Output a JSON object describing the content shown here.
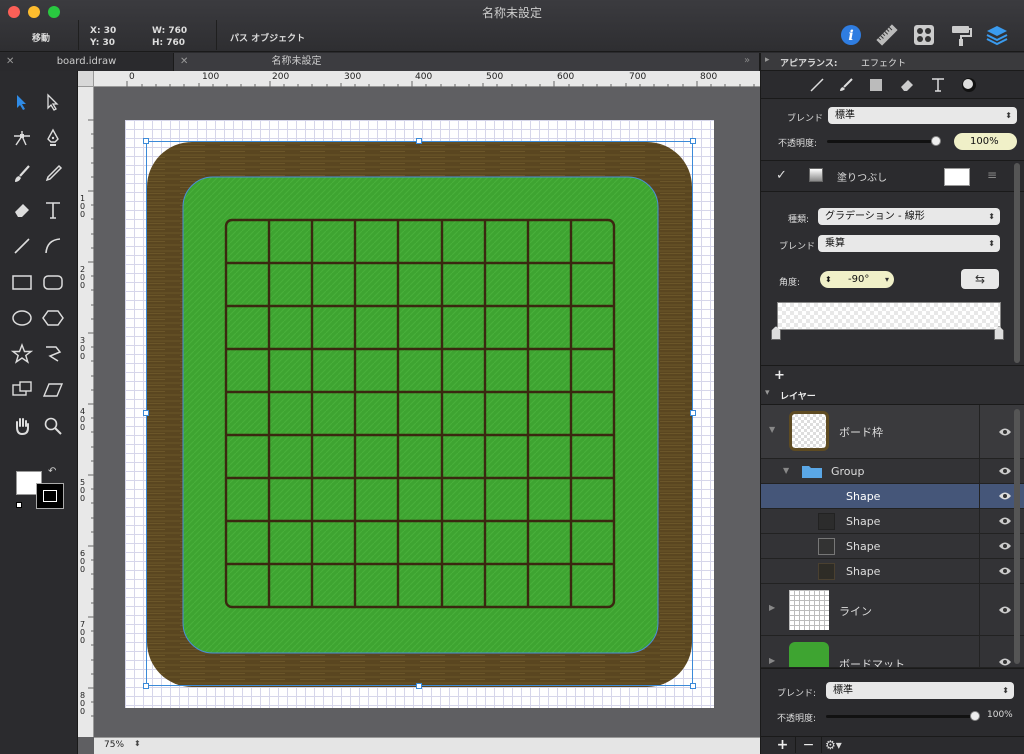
{
  "window": {
    "title": "名称未設定"
  },
  "toolbar": {
    "mode": "移動",
    "x_label": "X:",
    "x_val": "30",
    "y_label": "Y:",
    "y_val": "30",
    "w_label": "W:",
    "w_val": "760",
    "h_label": "H:",
    "h_val": "760",
    "object_type": "パス オブジェクト"
  },
  "tabs": [
    {
      "label": "board.idraw"
    },
    {
      "label": "名称未設定"
    }
  ],
  "ruler": {
    "top": [
      "0",
      "100",
      "200",
      "300",
      "400",
      "500",
      "600",
      "700",
      "800"
    ],
    "left": [
      "100",
      "200",
      "300",
      "400",
      "500",
      "600",
      "700",
      "800"
    ]
  },
  "status": {
    "zoom": "75%"
  },
  "inspector": {
    "header": "アピアランス:",
    "header_sub": "エフェクト",
    "blend_label": "ブレンド",
    "blend_value": "標準",
    "opacity_label": "不透明度:",
    "opacity_value": "100%",
    "fill_label": "塗りつぶし",
    "type_label": "種類:",
    "type_value": "グラデーション - 線形",
    "blend2_label": "ブレンド",
    "blend2_value": "乗算",
    "angle_label": "角度:",
    "angle_value": "-90°",
    "add": "+"
  },
  "layers": {
    "header": "レイヤー",
    "items": [
      {
        "name": "ボード枠"
      },
      {
        "name": "Group"
      },
      {
        "name": "Shape"
      },
      {
        "name": "Shape"
      },
      {
        "name": "Shape"
      },
      {
        "name": "Shape"
      },
      {
        "name": "ライン"
      },
      {
        "name": "ボードマット"
      }
    ],
    "bottom_blend_label": "ブレンド:",
    "bottom_blend_value": "標準",
    "bottom_opacity_label": "不透明度:",
    "bottom_opacity_value": "100%",
    "add": "+",
    "remove": "−"
  },
  "colors": {
    "accent": "#3478d6",
    "board_wood": "#5e4b22",
    "board_green": "#3fa832",
    "grid_line": "#3a2810"
  }
}
